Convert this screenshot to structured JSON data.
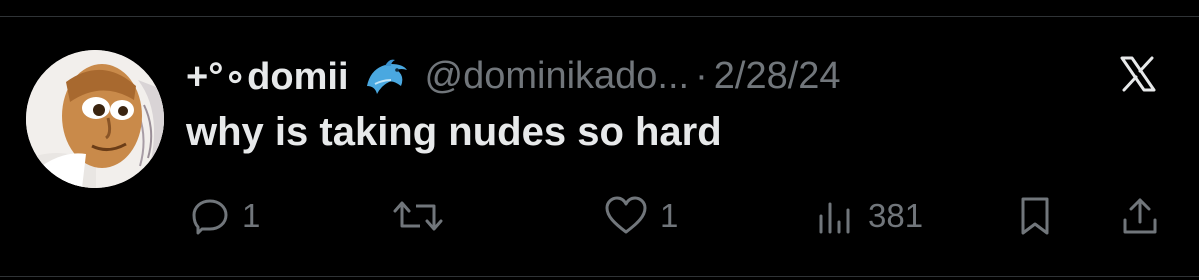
{
  "tweet": {
    "display_name": "+°∘domii",
    "handle": "@dominikado...",
    "separator": "·",
    "date": "2/28/24",
    "text": "why is taking nudes so hard"
  },
  "icons": {
    "emoji": "dolphin-emoji",
    "brand": "x-logo-icon",
    "reply": "reply-icon",
    "retweet": "retweet-icon",
    "like": "heart-icon",
    "views": "views-icon",
    "bookmark": "bookmark-icon",
    "share": "share-icon"
  },
  "actions": {
    "replies": "1",
    "likes": "1",
    "views": "381"
  },
  "colors": {
    "background": "#000000",
    "primary_text": "#e7e9ea",
    "secondary_text": "#71767b",
    "divider": "#2f3336",
    "emoji_blue": "#4aa8e0"
  }
}
